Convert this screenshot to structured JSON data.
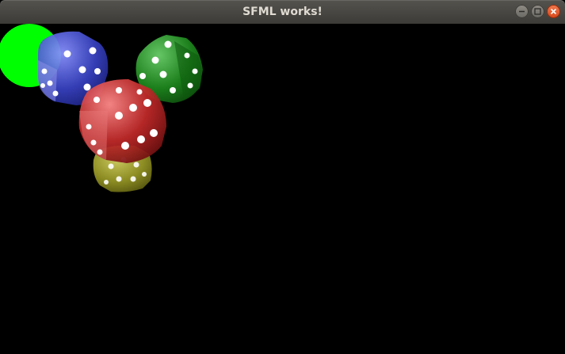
{
  "window": {
    "title": "SFML works!"
  },
  "controls": {
    "minimize_icon": "minimize-icon",
    "maximize_icon": "maximize-icon",
    "close_icon": "close-icon"
  },
  "scene": {
    "circle_color": "#00ff00",
    "dice_colors": {
      "blue": "#3a44c8",
      "green": "#1e8a1e",
      "yellow": "#a3a328",
      "red": "#c42a2a"
    }
  }
}
